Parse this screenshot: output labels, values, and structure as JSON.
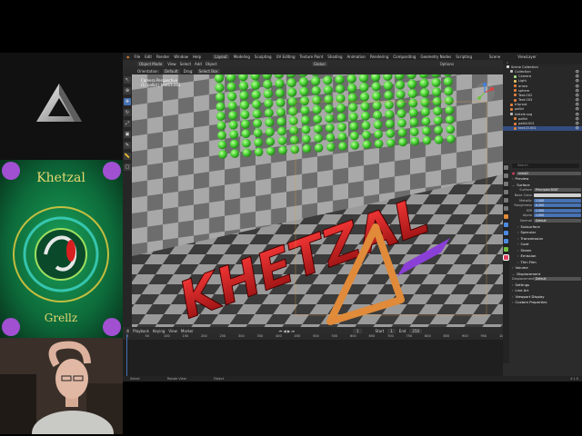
{
  "topbar": {
    "menus": [
      "File",
      "Edit",
      "Render",
      "Window",
      "Help"
    ],
    "workspaces": [
      "Layout",
      "Modeling",
      "Sculpting",
      "UV Editing",
      "Texture Paint",
      "Shading",
      "Animation",
      "Rendering",
      "Compositing",
      "Geometry Nodes",
      "Scripting"
    ],
    "active_workspace": "Layout",
    "scene": "Scene",
    "view_layer": "ViewLayer"
  },
  "header": {
    "mode": "Object Mode",
    "menus": [
      "View",
      "Select",
      "Add",
      "Object"
    ],
    "orientation": "Global",
    "options_label": "Options"
  },
  "tool_options": {
    "orientation_label": "Orientation:",
    "orientation_value": "Default",
    "drag_label": "Drag:",
    "drag_value": "Select Box"
  },
  "viewport": {
    "view_name": "Camera Perspective",
    "object_info": "(1) pallid | text13.001",
    "scene_text": "KHETZAL"
  },
  "timeline": {
    "menus": [
      "Playback",
      "Keying",
      "View",
      "Marker"
    ],
    "current_frame": "1",
    "start_label": "Start",
    "start": "1",
    "end_label": "End",
    "end": "250",
    "ticks": [
      "0",
      "50",
      "100",
      "150",
      "200",
      "250",
      "300",
      "350",
      "400",
      "450",
      "500",
      "550",
      "600",
      "650",
      "700",
      "750",
      "800",
      "850",
      "900",
      "950",
      "1000"
    ]
  },
  "statusbar": {
    "items": [
      "Select",
      "Rotate View",
      "Object"
    ],
    "version": "4.1.0"
  },
  "outliner": {
    "title": "Scene Collection",
    "rows": [
      {
        "name": "Collection",
        "color": "#bbbbbb",
        "indent": 1
      },
      {
        "name": "Camera",
        "color": "#a0e080",
        "indent": 2
      },
      {
        "name": "Light",
        "color": "#e0c060",
        "indent": 2
      },
      {
        "name": "arrow",
        "color": "#e08040",
        "indent": 2
      },
      {
        "name": "sphere",
        "color": "#e08040",
        "indent": 2
      },
      {
        "name": "Text.002",
        "color": "#e08040",
        "indent": 2
      },
      {
        "name": "Text.003",
        "color": "#e08040",
        "indent": 2
      },
      {
        "name": "triprout",
        "color": "#e08040",
        "indent": 1
      },
      {
        "name": "pallid",
        "color": "#e08040",
        "indent": 1
      },
      {
        "name": "kietzle.svg",
        "color": "#bbbbbb",
        "indent": 1
      },
      {
        "name": "pallid",
        "color": "#e08040",
        "indent": 2
      },
      {
        "name": "pallid.001",
        "color": "#e08040",
        "indent": 2
      },
      {
        "name": "text13.001",
        "color": "#e08040",
        "indent": 2
      }
    ]
  },
  "properties": {
    "search_placeholder": "Search",
    "material_slot": "metal2",
    "sections_top": [
      "Preview",
      "Surface"
    ],
    "surface_label": "Surface",
    "surface_value": "Principled BSDF",
    "fields": [
      {
        "label": "Base Color",
        "value": ""
      },
      {
        "label": "Metallic",
        "value": "1.000"
      },
      {
        "label": "Roughness",
        "value": "0.200"
      },
      {
        "label": "IOR",
        "value": "1.500"
      },
      {
        "label": "Alpha",
        "value": "1.000"
      },
      {
        "label": "Normal",
        "value": "Default"
      }
    ],
    "subsections": [
      "Subsurface",
      "Specular",
      "Transmission",
      "Coat",
      "Sheen",
      "Emission",
      "Thin Film"
    ],
    "bottom_sections": [
      "Volume",
      "Displacement"
    ],
    "displacement_label": "Displacement",
    "displacement_value": "Default",
    "settings_sections": [
      "Settings",
      "Line Art",
      "Viewport Display",
      "Custom Properties"
    ]
  },
  "album": {
    "title": "Khetzal",
    "subtitle": "Grellz"
  },
  "colors": {
    "accent": "#4772b3",
    "letters": "#c81d1d",
    "triangle": "#e08a3a",
    "purple_bar": "#8a3fd6",
    "spheres": "#44cc33"
  }
}
